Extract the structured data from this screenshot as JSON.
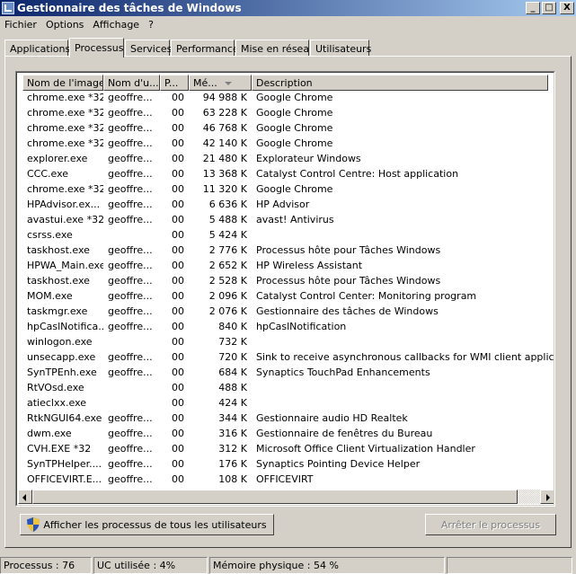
{
  "window": {
    "title": "Gestionnaire des tâches de Windows",
    "controls": {
      "minimize": "_",
      "maximize": "□",
      "close": "X"
    }
  },
  "menu": {
    "file": "Fichier",
    "options": "Options",
    "view": "Affichage",
    "help": "?"
  },
  "tabs": {
    "applications": "Applications",
    "processes": "Processus",
    "services": "Services",
    "performance": "Performance",
    "networking": "Mise en réseau",
    "users": "Utilisateurs"
  },
  "table": {
    "headers": {
      "image": "Nom de l'image",
      "user": "Nom d'u...",
      "cpu": "P...",
      "memory": "Mé...",
      "description": "Description"
    },
    "sort_column": "memory",
    "rows": [
      [
        "chrome.exe *32",
        "geoffre...",
        "00",
        "94 988 K",
        "Google Chrome"
      ],
      [
        "chrome.exe *32",
        "geoffre...",
        "00",
        "63 228 K",
        "Google Chrome"
      ],
      [
        "chrome.exe *32",
        "geoffre...",
        "00",
        "46 768 K",
        "Google Chrome"
      ],
      [
        "chrome.exe *32",
        "geoffre...",
        "00",
        "42 140 K",
        "Google Chrome"
      ],
      [
        "explorer.exe",
        "geoffre...",
        "00",
        "21 480 K",
        "Explorateur Windows"
      ],
      [
        "CCC.exe",
        "geoffre...",
        "00",
        "13 368 K",
        "Catalyst Control Centre: Host application"
      ],
      [
        "chrome.exe *32",
        "geoffre...",
        "00",
        "11 320 K",
        "Google Chrome"
      ],
      [
        "HPAdvisor.ex...",
        "geoffre...",
        "00",
        "6 636 K",
        "HP Advisor"
      ],
      [
        "avastui.exe *32",
        "geoffre...",
        "00",
        "5 488 K",
        "avast! Antivirus"
      ],
      [
        "csrss.exe",
        "",
        "00",
        "5 424 K",
        ""
      ],
      [
        "taskhost.exe",
        "geoffre...",
        "00",
        "2 776 K",
        "Processus hôte pour Tâches Windows"
      ],
      [
        "HPWA_Main.exe",
        "geoffre...",
        "00",
        "2 652 K",
        "HP Wireless Assistant"
      ],
      [
        "taskhost.exe",
        "geoffre...",
        "00",
        "2 528 K",
        "Processus hôte pour Tâches Windows"
      ],
      [
        "MOM.exe",
        "geoffre...",
        "00",
        "2 096 K",
        "Catalyst Control Center: Monitoring program"
      ],
      [
        "taskmgr.exe",
        "geoffre...",
        "00",
        "2 076 K",
        "Gestionnaire des tâches de Windows"
      ],
      [
        "hpCaslNotifica...",
        "geoffre...",
        "00",
        "840 K",
        "hpCaslNotification"
      ],
      [
        "winlogon.exe",
        "",
        "00",
        "732 K",
        ""
      ],
      [
        "unsecapp.exe",
        "geoffre...",
        "00",
        "720 K",
        "Sink to receive asynchronous callbacks for WMI client application"
      ],
      [
        "SynTPEnh.exe",
        "geoffre...",
        "00",
        "684 K",
        "Synaptics TouchPad Enhancements"
      ],
      [
        "RtVOsd.exe",
        "",
        "00",
        "488 K",
        ""
      ],
      [
        "atieclxx.exe",
        "",
        "00",
        "424 K",
        ""
      ],
      [
        "RtkNGUI64.exe",
        "geoffre...",
        "00",
        "344 K",
        "Gestionnaire audio HD Realtek"
      ],
      [
        "dwm.exe",
        "geoffre...",
        "00",
        "316 K",
        "Gestionnaire de fenêtres du Bureau"
      ],
      [
        "CVH.EXE *32",
        "geoffre...",
        "00",
        "312 K",
        "Microsoft Office Client Virtualization Handler"
      ],
      [
        "SynTPHelper....",
        "geoffre...",
        "00",
        "176 K",
        "Synaptics Pointing Device Helper"
      ],
      [
        "OFFICEVIRT.E...",
        "geoffre...",
        "00",
        "108 K",
        "OFFICEVIRT"
      ]
    ]
  },
  "buttons": {
    "show_all": "Afficher les processus de tous les utilisateurs",
    "end_process": "Arrêter le processus"
  },
  "status": {
    "processes": "Processus : 76",
    "cpu": "UC utilisée : 4%",
    "memory": "Mémoire physique : 54 %"
  }
}
